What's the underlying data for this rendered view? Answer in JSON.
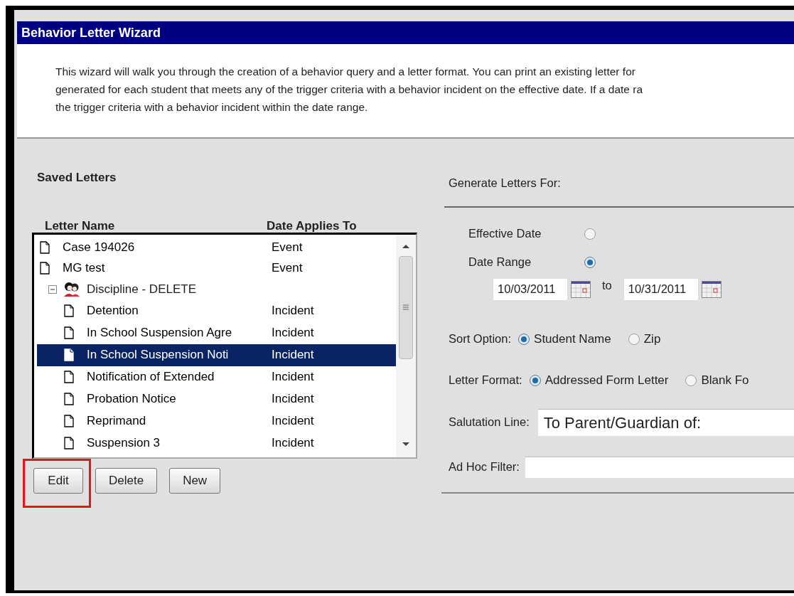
{
  "window": {
    "title": "Behavior Letter Wizard"
  },
  "description": [
    "This wizard will walk you through the creation of a behavior query and a letter format. You can print an existing letter for",
    "generated for each student that meets any of the trigger criteria with a behavior incident on the effective date. If a date ra",
    "the trigger criteria with a behavior incident within the date range."
  ],
  "saved_letters": {
    "title": "Saved Letters",
    "columns": [
      "Letter Name",
      "Date Applies To"
    ],
    "items": [
      {
        "kind": "letter",
        "name": "Case 194026",
        "applies_to": "Event",
        "selected": false
      },
      {
        "kind": "letter",
        "name": "MG test",
        "applies_to": "Event",
        "selected": false
      },
      {
        "kind": "folder",
        "name": "Discipline - DELETE",
        "expanded": true,
        "children": [
          {
            "kind": "letter",
            "name": "Detention",
            "applies_to": "Incident",
            "selected": false
          },
          {
            "kind": "letter",
            "name": "In School Suspension Agre",
            "applies_to": "Incident",
            "selected": false
          },
          {
            "kind": "letter",
            "name": "In School Suspension Noti",
            "applies_to": "Incident",
            "selected": true
          },
          {
            "kind": "letter",
            "name": "Notification of Extended",
            "applies_to": "Incident",
            "selected": false
          },
          {
            "kind": "letter",
            "name": "Probation Notice",
            "applies_to": "Incident",
            "selected": false
          },
          {
            "kind": "letter",
            "name": "Reprimand",
            "applies_to": "Incident",
            "selected": false
          },
          {
            "kind": "letter",
            "name": "Suspension 3",
            "applies_to": "Incident",
            "selected": false
          }
        ]
      }
    ],
    "buttons": [
      {
        "label": "Edit",
        "highlighted": true
      },
      {
        "label": "Delete",
        "highlighted": false
      },
      {
        "label": "New",
        "highlighted": false
      }
    ]
  },
  "generate": {
    "title": "Generate Letters For:",
    "options": [
      {
        "label": "Effective Date",
        "selected": false
      },
      {
        "label": "Date Range",
        "selected": true
      }
    ],
    "date_from": "10/03/2011",
    "to_label": "to",
    "date_to": "10/31/2011",
    "sort_option": {
      "label": "Sort Option:",
      "options": [
        {
          "label": "Student Name",
          "selected": true
        },
        {
          "label": "Zip",
          "selected": false
        }
      ]
    },
    "letter_format": {
      "label": "Letter Format:",
      "options": [
        {
          "label": "Addressed Form Letter",
          "selected": true
        },
        {
          "label": "Blank Fo",
          "selected": false
        }
      ]
    },
    "salutation": {
      "label": "Salutation Line:",
      "value": "To Parent/Guardian of:"
    },
    "ad_hoc_filter": {
      "label": "Ad Hoc Filter:"
    }
  }
}
